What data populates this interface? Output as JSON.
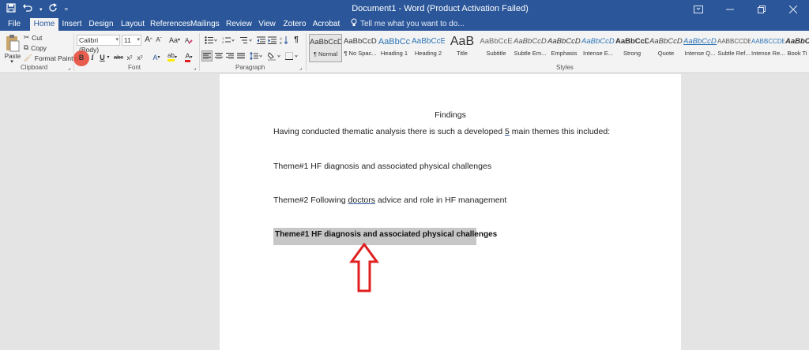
{
  "titlebar": {
    "title": "Document1 - Word (Product Activation Failed)",
    "qat_icons": [
      "save-icon",
      "undo-icon",
      "redo-icon",
      "customize-icon"
    ]
  },
  "tabs": [
    "File",
    "Home",
    "Insert",
    "Design",
    "Layout",
    "References",
    "Mailings",
    "Review",
    "View",
    "Zotero",
    "Acrobat"
  ],
  "active_tab": "Home",
  "tell_me": "Tell me what you want to do...",
  "clipboard": {
    "paste": "Paste",
    "cut": "Cut",
    "copy": "Copy",
    "format_painter": "Format Painter",
    "label": "Clipboard"
  },
  "font": {
    "name": "Calibri (Body)",
    "size": "11",
    "grow": "A",
    "shrink": "A",
    "case": "Aa",
    "bold": "B",
    "italic": "I",
    "underline": "U",
    "strike": "abc",
    "sub": "x",
    "sup": "x",
    "effects": "A",
    "highlight": "ab",
    "color": "A",
    "label": "Font"
  },
  "paragraph": {
    "label": "Paragraph",
    "pilcrow": "¶"
  },
  "styles": {
    "label": "Styles",
    "items": [
      {
        "preview": "AaBbCcDc",
        "name": "¶ Normal"
      },
      {
        "preview": "AaBbCcDc",
        "name": "¶ No Spac..."
      },
      {
        "preview": "AaBbCc",
        "name": "Heading 1"
      },
      {
        "preview": "AaBbCcE",
        "name": "Heading 2"
      },
      {
        "preview": "AaB",
        "name": "Title"
      },
      {
        "preview": "AaBbCcE",
        "name": "Subtitle"
      },
      {
        "preview": "AaBbCcDc",
        "name": "Subtle Em..."
      },
      {
        "preview": "AaBbCcDc",
        "name": "Emphasis"
      },
      {
        "preview": "AaBbCcDc",
        "name": "Intense E..."
      },
      {
        "preview": "AaBbCcDc",
        "name": "Strong"
      },
      {
        "preview": "AaBbCcDc",
        "name": "Quote"
      },
      {
        "preview": "AaBbCcDc",
        "name": "Intense Q..."
      },
      {
        "preview": "AABBCCDE",
        "name": "Subtle Ref..."
      },
      {
        "preview": "AABBCCDE",
        "name": "Intense Re..."
      },
      {
        "preview": "AaBbCcDc",
        "name": "Book Ti"
      }
    ]
  },
  "document": {
    "heading": "Findings",
    "intro_before": "Having conducted thematic analysis there is such a developed ",
    "intro_underlined": "5",
    "intro_after": " main themes this included:",
    "theme1": "Theme#1 HF diagnosis and associated physical challenges",
    "theme2_before": "Theme#2 Following ",
    "theme2_underlined": "doctors",
    "theme2_after": " advice and role in HF management",
    "selected_text": "Theme#1 HF diagnosis and associated physical challenges"
  },
  "colors": {
    "accent": "#2b579a",
    "arrow": "#e02020",
    "record": "#e74c3c",
    "selection": "#c7c7c7"
  }
}
